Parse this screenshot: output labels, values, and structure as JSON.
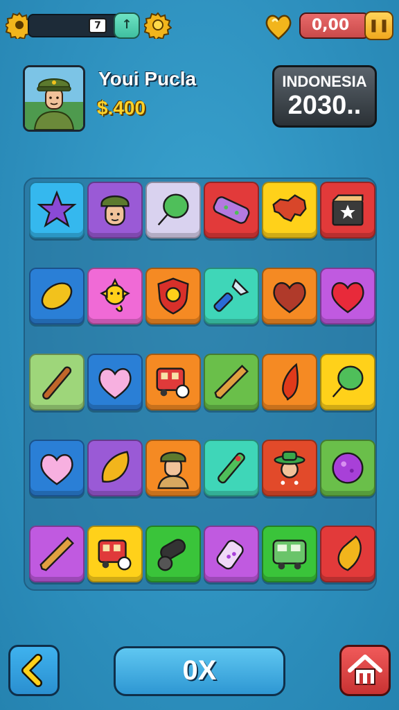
{
  "hud": {
    "level": "7",
    "up_icon": "arrow-up-icon",
    "money": "0,00",
    "pause_icon": "pause-icon",
    "currency_icon": "heart-gem-icon"
  },
  "profile": {
    "name": "Youi Pucla",
    "coins": "$.400",
    "avatar": "soldier-portrait"
  },
  "country": {
    "name": "INDONESIA",
    "year": "2030.."
  },
  "board": {
    "rows": [
      [
        {
          "icon": "star-icon",
          "bg": "#35b8ee"
        },
        {
          "icon": "soldier-face-icon",
          "bg": "#9a5ad6"
        },
        {
          "icon": "balloon-icon",
          "bg": "#d9d2ef"
        },
        {
          "icon": "bandage-icon",
          "bg": "#e23a3a"
        },
        {
          "icon": "map-icon",
          "bg": "#ffd11a"
        },
        {
          "icon": "box-star-icon",
          "bg": "#e23a3a"
        }
      ],
      [
        {
          "icon": "lemon-icon",
          "bg": "#2a7fd6"
        },
        {
          "icon": "sun-creature-icon",
          "bg": "#f06ad6"
        },
        {
          "icon": "shield-emblem-icon",
          "bg": "#f58a23"
        },
        {
          "icon": "flashlight-icon",
          "bg": "#3fd6b8"
        },
        {
          "icon": "heart-icon",
          "bg": "#f58a23"
        },
        {
          "icon": "heart-icon",
          "bg": "#c05ae0"
        }
      ],
      [
        {
          "icon": "stick-icon",
          "bg": "#9ed67a"
        },
        {
          "icon": "heart-icon",
          "bg": "#2a7fd6"
        },
        {
          "icon": "bus-ball-icon",
          "bg": "#f58a23"
        },
        {
          "icon": "cone-icon",
          "bg": "#6abf4a"
        },
        {
          "icon": "chili-icon",
          "bg": "#f58a23"
        },
        {
          "icon": "balloon-icon",
          "bg": "#ffd11a"
        }
      ],
      [
        {
          "icon": "heart-icon",
          "bg": "#2a7fd6"
        },
        {
          "icon": "leaf-icon",
          "bg": "#9a5ad6"
        },
        {
          "icon": "soldier-icon",
          "bg": "#f58a23"
        },
        {
          "icon": "marker-icon",
          "bg": "#3fd6b8"
        },
        {
          "icon": "hat-person-icon",
          "bg": "#e24a2a"
        },
        {
          "icon": "ball-icon",
          "bg": "#6abf4a"
        }
      ],
      [
        {
          "icon": "cone-icon",
          "bg": "#c05ae0"
        },
        {
          "icon": "bus-ball-icon",
          "bg": "#ffd11a"
        },
        {
          "icon": "cannon-icon",
          "bg": "#3ac43a"
        },
        {
          "icon": "bottle-icon",
          "bg": "#c05ae0"
        },
        {
          "icon": "bus-icon",
          "bg": "#3ac43a"
        },
        {
          "icon": "shell-icon",
          "bg": "#e23a3a"
        }
      ]
    ]
  },
  "buttons": {
    "ok_label": "0X",
    "back_icon": "chevron-left-icon",
    "home_icon": "home-icon"
  }
}
